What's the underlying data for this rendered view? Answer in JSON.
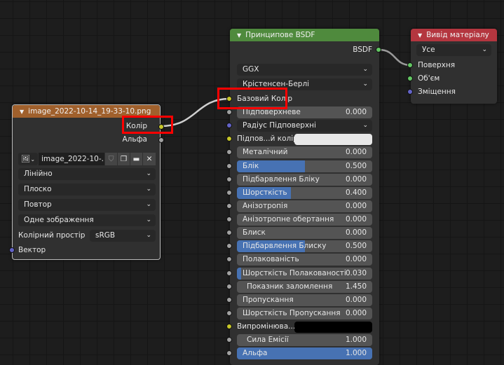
{
  "image_node": {
    "title": "image_2022-10-14_19-33-10.png",
    "header_color": "#a0602c",
    "outputs": [
      "Колір",
      "Альфа"
    ],
    "image_name": "image_2022-10-...",
    "dropdowns": [
      "Лінійно",
      "Плоско",
      "Повтор",
      "Одне зображення"
    ],
    "colorspace_label": "Колірний простір",
    "colorspace_value": "sRGB",
    "input": "Вектор"
  },
  "bsdf_node": {
    "title": "Принципове BSDF",
    "header_color": "#4f8a3d",
    "output": "BSDF",
    "rows": [
      {
        "type": "dropdown",
        "label": "GGX"
      },
      {
        "type": "dropdown",
        "label": "Крістенсен-Берлі"
      },
      {
        "type": "socket",
        "label": "Базовий Колір",
        "socket": "#c7c729"
      },
      {
        "type": "slider",
        "label": "Підповерхневе",
        "value": "0.000",
        "fill": 0,
        "socket": "#a1a1a1"
      },
      {
        "type": "dropdown",
        "label": "Радіус Підповерхні",
        "socket": "#6363c7"
      },
      {
        "type": "color",
        "label": "Підпов...й колір",
        "color": "#e8e8e8",
        "socket": "#c7c729"
      },
      {
        "type": "slider",
        "label": "Металічний",
        "value": "0.000",
        "fill": 0,
        "socket": "#a1a1a1"
      },
      {
        "type": "slider",
        "label": "Блік",
        "value": "0.500",
        "fill": 0.5,
        "socket": "#a1a1a1"
      },
      {
        "type": "slider",
        "label": "Підбарвлення Бліку",
        "value": "0.000",
        "fill": 0,
        "socket": "#a1a1a1"
      },
      {
        "type": "slider",
        "label": "Шорсткість",
        "value": "0.400",
        "fill": 0.4,
        "socket": "#a1a1a1"
      },
      {
        "type": "slider",
        "label": "Анізотропія",
        "value": "0.000",
        "fill": 0,
        "socket": "#a1a1a1"
      },
      {
        "type": "slider",
        "label": "Анізотропне обертання",
        "value": "0.000",
        "fill": 0,
        "socket": "#a1a1a1"
      },
      {
        "type": "slider",
        "label": "Блиск",
        "value": "0.000",
        "fill": 0,
        "socket": "#a1a1a1"
      },
      {
        "type": "slider",
        "label": "Підбарвлення Блиску",
        "value": "0.500",
        "fill": 0.5,
        "socket": "#a1a1a1"
      },
      {
        "type": "slider",
        "label": "Полакованість",
        "value": "0.000",
        "fill": 0,
        "socket": "#a1a1a1"
      },
      {
        "type": "slider",
        "label": "Шорсткість Полакованості",
        "value": "0.030",
        "fill": 0.03,
        "socket": "#a1a1a1"
      },
      {
        "type": "number",
        "label": "Показник заломлення",
        "value": "1.450",
        "socket": "#a1a1a1"
      },
      {
        "type": "slider",
        "label": "Пропускання",
        "value": "0.000",
        "fill": 0,
        "socket": "#a1a1a1"
      },
      {
        "type": "slider",
        "label": "Шорсткість Пропускання",
        "value": "0.000",
        "fill": 0,
        "socket": "#a1a1a1"
      },
      {
        "type": "color",
        "label": "Випромінюва...",
        "color": "#000000",
        "socket": "#c7c729"
      },
      {
        "type": "number",
        "label": "Сила Емісії",
        "value": "1.000",
        "socket": "#a1a1a1"
      },
      {
        "type": "slider",
        "label": "Альфа",
        "value": "1.000",
        "fill": 1,
        "socket": "#a1a1a1"
      }
    ]
  },
  "output_node": {
    "title": "Вивід матеріалу",
    "header_color": "#b4363f",
    "target": "Усе",
    "inputs": [
      {
        "label": "Поверхня",
        "socket": "#63c763"
      },
      {
        "label": "Об'єм",
        "socket": "#63c763"
      },
      {
        "label": "Зміщення",
        "socket": "#6363c7"
      }
    ]
  }
}
